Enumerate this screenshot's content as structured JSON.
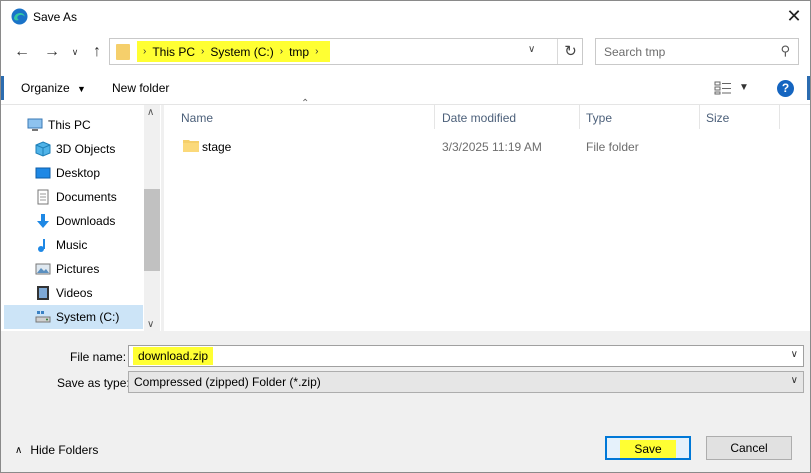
{
  "window": {
    "title": "Save As"
  },
  "nav": {
    "back_icon": "back-arrow-icon",
    "forward_icon": "forward-arrow-icon",
    "recent_icon": "chevron-down-icon",
    "up_icon": "up-arrow-icon"
  },
  "address": {
    "crumbs": [
      "This PC",
      "System (C:)",
      "tmp"
    ],
    "highlight_color": "#ffff33"
  },
  "search": {
    "placeholder": "Search tmp"
  },
  "toolbar": {
    "organize_label": "Organize",
    "new_folder_label": "New folder",
    "help_label": "?"
  },
  "sidebar": {
    "items": [
      {
        "label": "This PC",
        "icon": "computer-icon"
      },
      {
        "label": "3D Objects",
        "icon": "cube-icon"
      },
      {
        "label": "Desktop",
        "icon": "desktop-icon"
      },
      {
        "label": "Documents",
        "icon": "document-icon"
      },
      {
        "label": "Downloads",
        "icon": "download-icon"
      },
      {
        "label": "Music",
        "icon": "music-icon"
      },
      {
        "label": "Pictures",
        "icon": "picture-icon"
      },
      {
        "label": "Videos",
        "icon": "video-icon"
      },
      {
        "label": "System (C:)",
        "icon": "drive-icon",
        "selected": true
      }
    ]
  },
  "files": {
    "columns": [
      "Name",
      "Date modified",
      "Type",
      "Size"
    ],
    "rows": [
      {
        "name": "stage",
        "date": "3/3/2025 11:19 AM",
        "type": "File folder",
        "size": ""
      }
    ]
  },
  "form": {
    "filename_label": "File name:",
    "filename_value": "download.zip",
    "savetype_label": "Save as type:",
    "savetype_value": "Compressed (zipped) Folder (*.zip)"
  },
  "footer": {
    "hide_folders_label": "Hide Folders",
    "save_label": "Save",
    "cancel_label": "Cancel"
  }
}
